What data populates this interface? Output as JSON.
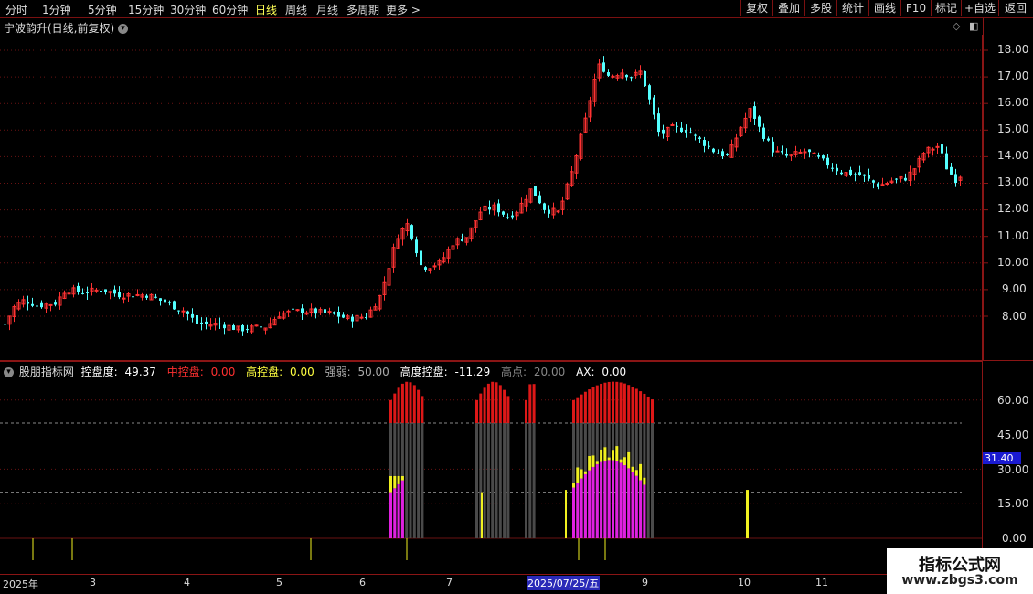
{
  "toolbar": {
    "periods": [
      "分时",
      "1分钟",
      "5分钟",
      "15分钟",
      "30分钟",
      "60分钟",
      "日线",
      "周线",
      "月线",
      "多周期",
      "更多 >"
    ],
    "active_period": "日线",
    "right_buttons": [
      "复权",
      "叠加",
      "多股",
      "统计",
      "画线",
      "F10",
      "标记",
      "+自选",
      "返回"
    ]
  },
  "main_chart": {
    "title": "宁波韵升(日线,前复权)",
    "price_ticks": [
      "18.00",
      "17.00",
      "16.00",
      "15.00",
      "14.00",
      "13.00",
      "12.00",
      "11.00",
      "10.00",
      "9.00",
      "8.00"
    ],
    "up_color": "#ff3232",
    "down_color": "#54ffff"
  },
  "indicator": {
    "name": "股朋指标网",
    "items": [
      {
        "label": "控盘度:",
        "value": "49.37",
        "color": "#ffffff"
      },
      {
        "label": "中控盘:",
        "value": "0.00",
        "color": "#ff3030"
      },
      {
        "label": "高控盘:",
        "value": "0.00",
        "color": "#ffff40"
      },
      {
        "label": "强弱:",
        "value": "50.00",
        "color": "#aaaaaa"
      },
      {
        "label": "高度控盘:",
        "value": "-11.29",
        "color": "#ffffff"
      },
      {
        "label": "高点:",
        "value": "20.00",
        "color": "#888888"
      },
      {
        "label": "AX:",
        "value": "0.00",
        "color": "#ffffff"
      }
    ],
    "ticks": [
      "60.00",
      "45.00",
      "30.00",
      "15.00",
      "0.00"
    ],
    "current_value": "31.40"
  },
  "x_axis": {
    "labels": [
      "2025年",
      "3",
      "4",
      "5",
      "6",
      "7",
      "9",
      "10",
      "11"
    ],
    "highlight": "2025/07/25/五"
  },
  "watermark": {
    "line1": "指标公式网",
    "line2": "www.zbgs3.com"
  }
}
